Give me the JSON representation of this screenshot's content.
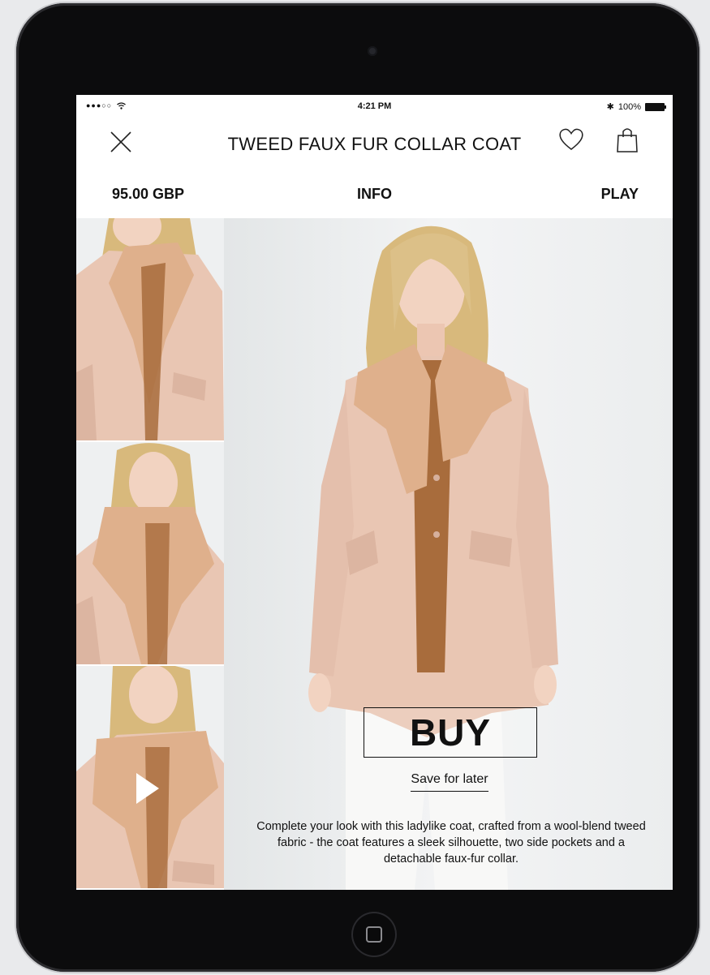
{
  "status_bar": {
    "signal": "●●●○○",
    "time": "4:21 PM",
    "bluetooth": "✱",
    "battery": "100%"
  },
  "header": {
    "title": "TWEED FAUX FUR COLLAR COAT"
  },
  "subnav": {
    "price": "95.00 GBP",
    "info": "INFO",
    "play": "PLAY"
  },
  "product": {
    "buy_label": "BUY",
    "save_label": "Save for later",
    "description": "Complete your look with this ladylike coat, crafted from a wool-blend tweed fabric - the coat features a sleek silhouette, two side pockets and a detachable faux-fur collar."
  },
  "colors": {
    "coat": "#e9c6b3",
    "fur": "#dfb08c",
    "hair": "#d8b97c",
    "skin": "#f2d3c1",
    "top": "#a86c3c",
    "backdrop": "#eef0f1"
  },
  "icons": {
    "close": "close-icon",
    "favorite": "heart-icon",
    "bag": "shopping-bag-icon",
    "play": "play-icon"
  }
}
